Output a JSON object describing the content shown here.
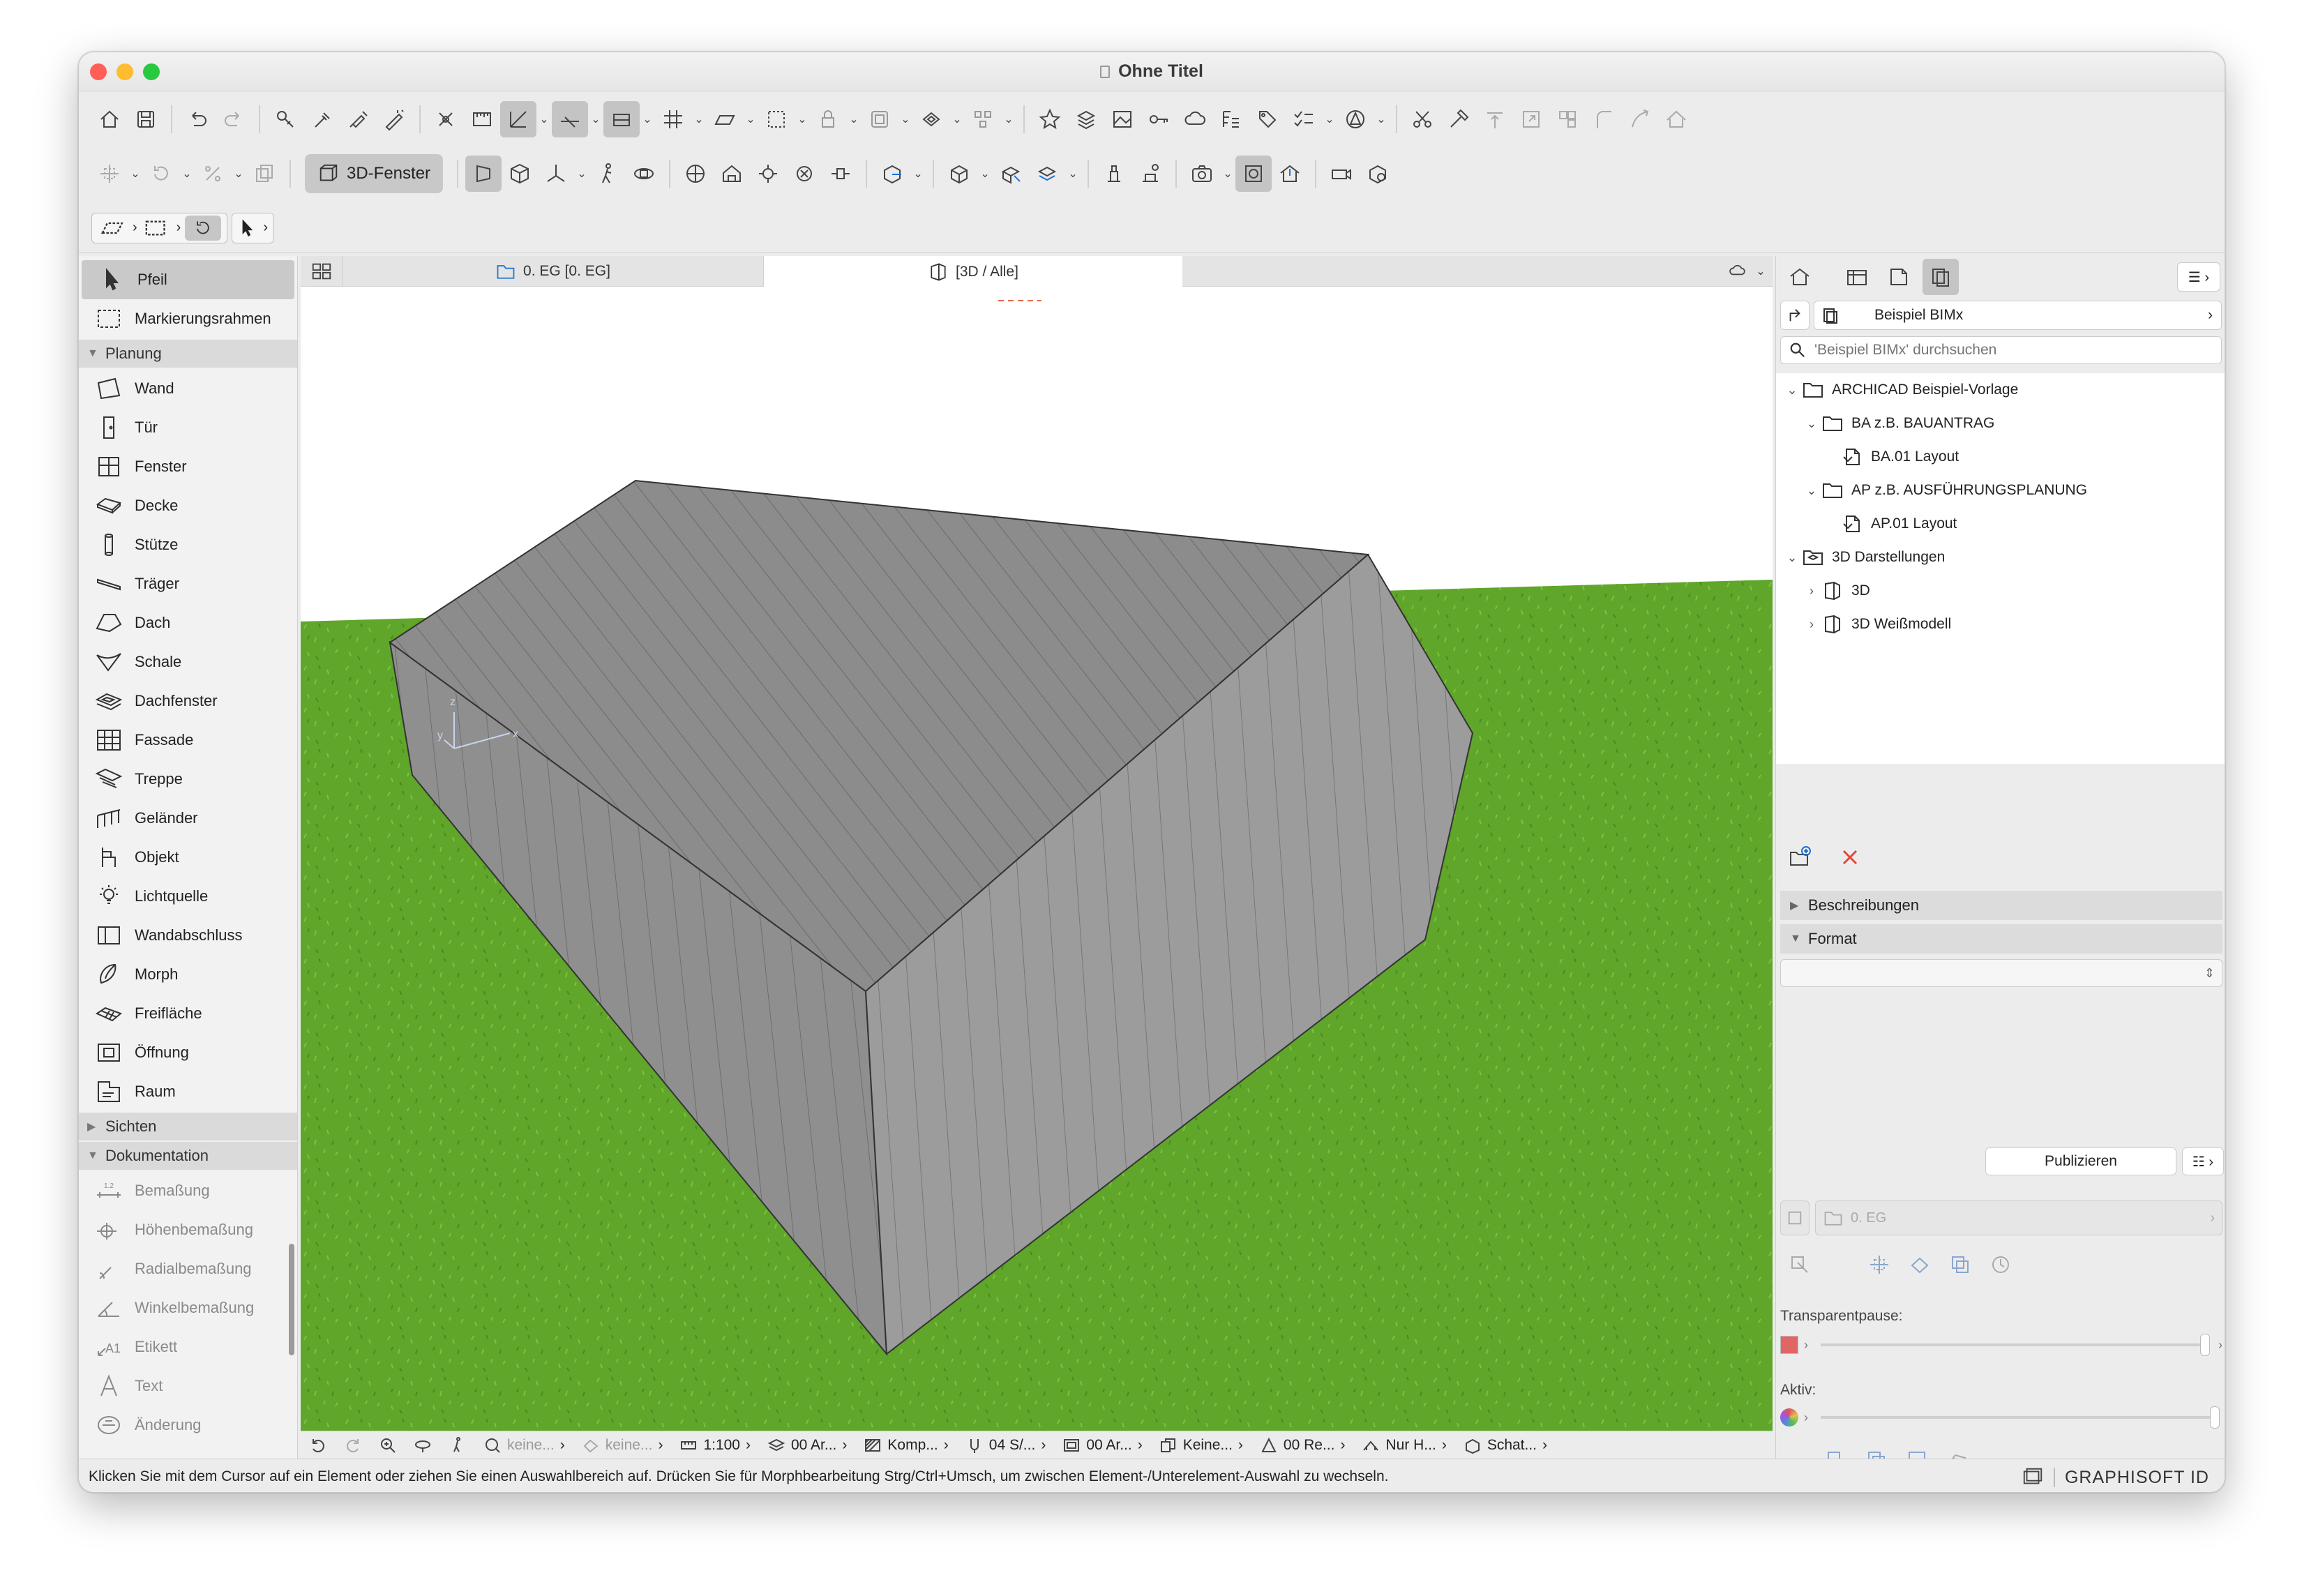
{
  "window": {
    "title": "Ohne Titel"
  },
  "colors": {
    "close": "#ff5f57",
    "minimize": "#febc2e",
    "zoom": "#28c840",
    "grass": "#5fa62a",
    "roof": "#8a8a8a",
    "wall": "#9a9a9a",
    "red_x": "#e2463a"
  },
  "toolbar2": {
    "view3d_label": "3D-Fenster"
  },
  "left_panel": {
    "top_items": [
      {
        "label": "Pfeil",
        "icon": "arrow-icon"
      },
      {
        "label": "Markierungsrahmen",
        "icon": "marquee-icon"
      }
    ],
    "section_planung": "Planung",
    "planung_items": [
      {
        "label": "Wand"
      },
      {
        "label": "Tür"
      },
      {
        "label": "Fenster"
      },
      {
        "label": "Decke"
      },
      {
        "label": "Stütze"
      },
      {
        "label": "Träger"
      },
      {
        "label": "Dach"
      },
      {
        "label": "Schale"
      },
      {
        "label": "Dachfenster"
      },
      {
        "label": "Fassade"
      },
      {
        "label": "Treppe"
      },
      {
        "label": "Geländer"
      },
      {
        "label": "Objekt"
      },
      {
        "label": "Lichtquelle"
      },
      {
        "label": "Wandabschluss"
      },
      {
        "label": "Morph"
      },
      {
        "label": "Freifläche"
      },
      {
        "label": "Öffnung"
      },
      {
        "label": "Raum"
      }
    ],
    "section_sichten": "Sichten",
    "section_dokumentation": "Dokumentation",
    "doku_items": [
      {
        "label": "Bemaßung"
      },
      {
        "label": "Höhenbemaßung"
      },
      {
        "label": "Radialbemaßung"
      },
      {
        "label": "Winkelbemaßung"
      },
      {
        "label": "Etikett"
      },
      {
        "label": "Text"
      },
      {
        "label": "Änderung"
      }
    ]
  },
  "tabs": {
    "floorplan": "0. EG [0. EG]",
    "view3d": "[3D / Alle]"
  },
  "navbar": {
    "layer": "keine...",
    "layer2": "keine...",
    "scale": "1:100",
    "layers": "00 Ar...",
    "pen": "Komp...",
    "struct": "04 S/...",
    "model": "00 Ar...",
    "renov": "Keine...",
    "graphic": "00 Re...",
    "partial": "Nur H...",
    "shadow": "Schat..."
  },
  "status": {
    "message": "Klicken Sie mit dem Cursor auf ein Element oder ziehen Sie einen Auswahlbereich auf. Drücken Sie für Morphbearbeitung Strg/Ctrl+Umsch, um zwischen Element-/Unterelement-Auswahl zu wechseln.",
    "brand": "GRAPHISOFT ID"
  },
  "right_panel": {
    "set_name": "Beispiel BIMx",
    "search_placeholder": "'Beispiel BIMx' durchsuchen",
    "tree": [
      {
        "label": "ARCHICAD Beispiel-Vorlage",
        "level": 0,
        "type": "folder",
        "expanded": true
      },
      {
        "label": "BA z.B. BAUANTRAG",
        "level": 1,
        "type": "folder",
        "expanded": true
      },
      {
        "label": "BA.01 Layout",
        "level": 2,
        "type": "layout"
      },
      {
        "label": "AP z.B. AUSFÜHRUNGSPLANUNG",
        "level": 1,
        "type": "folder",
        "expanded": true
      },
      {
        "label": "AP.01 Layout",
        "level": 2,
        "type": "layout"
      },
      {
        "label": "3D Darstellungen",
        "level": 0,
        "type": "folder3d",
        "expanded": true
      },
      {
        "label": "3D",
        "level": 1,
        "type": "view3d",
        "expanded": false
      },
      {
        "label": "3D Weißmodell",
        "level": 1,
        "type": "view3d",
        "expanded": false
      }
    ],
    "beschreibungen": "Beschreibungen",
    "format": "Format",
    "publish_label": "Publizieren",
    "story_field": "0. EG",
    "transparent_label": "Transparentpause:",
    "active_label": "Aktiv:"
  }
}
